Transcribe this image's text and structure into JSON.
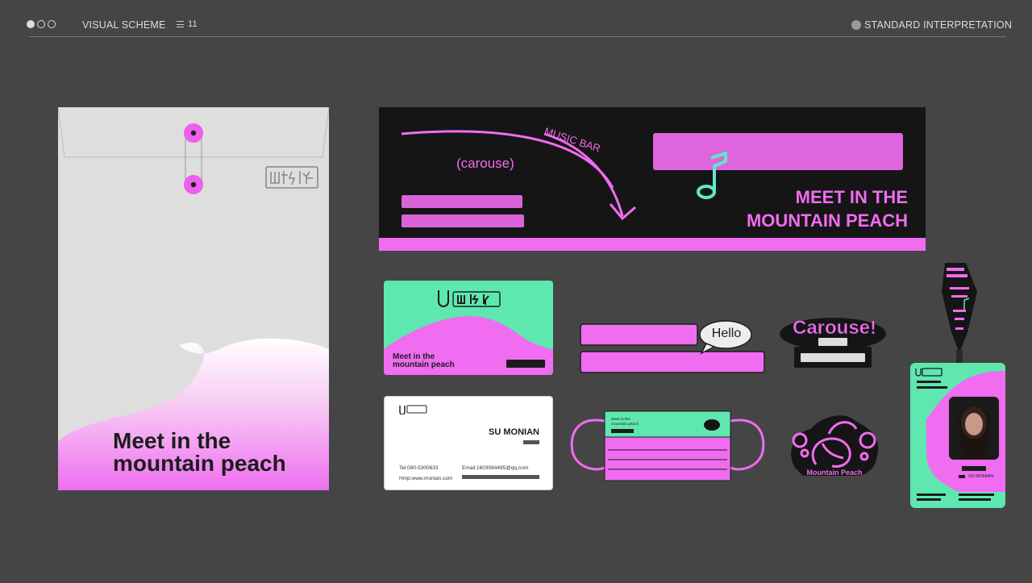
{
  "header": {
    "section": "VISUAL SCHEME",
    "page_number": "11",
    "right_label": "STANDARD INTERPRETATION"
  },
  "billboard": {
    "music_bar": "MUSIC BAR",
    "carouse": "(carouse)",
    "meet_line1": "MEET IN THE",
    "meet_line2": "MOUNTAIN PEACH"
  },
  "envelope": {
    "tagline_line1": "Meet in the",
    "tagline_line2": "mountain peach"
  },
  "gift_card": {
    "tagline_line1": "Meet in the",
    "tagline_line2": "mountain peach"
  },
  "business_card": {
    "name": "SU MONIAN",
    "tel": "Tel:080-5300633",
    "email": "Email:1603084495@qq.com",
    "website": "Hmp:www.monian.com"
  },
  "sticker_hello": {
    "bubble": "Hello"
  },
  "sticker_carouse": {
    "title": "Carouse!"
  },
  "sticker_peach": {
    "label": "Mountain Peach"
  },
  "mask": {
    "tagline_line1": "Meet in the",
    "tagline_line2": "mountain peach"
  },
  "badge": {
    "name_en": "SU MONIAN"
  },
  "colors": {
    "accent_pink": "#f06cf0",
    "mint": "#5ee8b0",
    "dark_bg": "#454545",
    "black": "#151515"
  }
}
